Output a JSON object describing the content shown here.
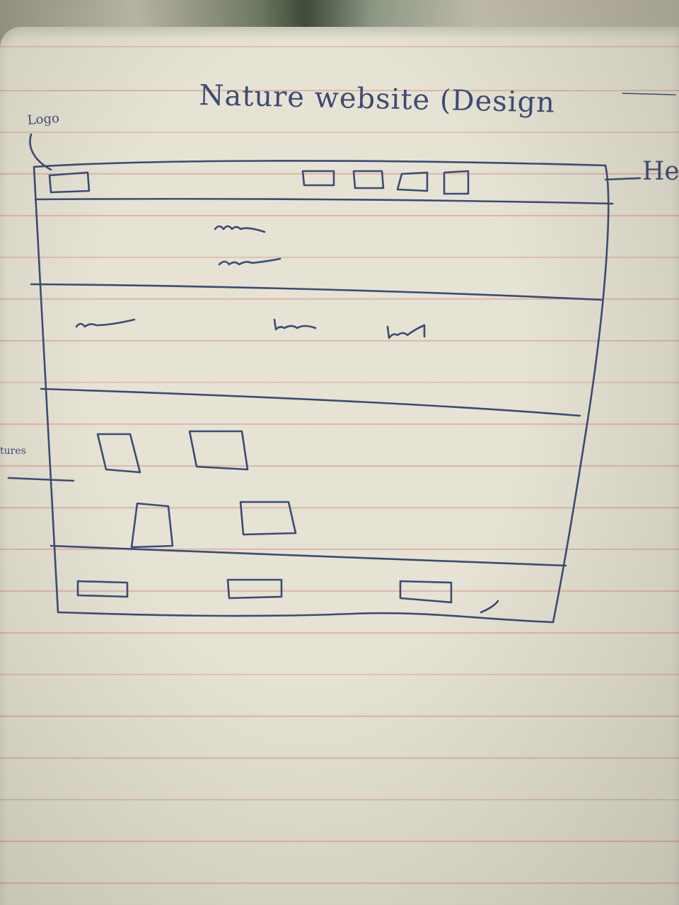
{
  "sketch": {
    "title": "Nature website (Design",
    "annotations": {
      "logo": "Logo",
      "header": "He",
      "features": "tures"
    },
    "header": {
      "logo_box_count": 1,
      "nav_box_count": 4
    },
    "sections": [
      {
        "name": "hero",
        "squiggle_count": 2
      },
      {
        "name": "text-row",
        "squiggle_count": 3
      },
      {
        "name": "features",
        "box_count": 4
      },
      {
        "name": "footer",
        "box_count": 3
      }
    ],
    "ink_color": "#3d4a74",
    "line_color": "#d6968c",
    "paper_color": "#e6e3d4"
  }
}
